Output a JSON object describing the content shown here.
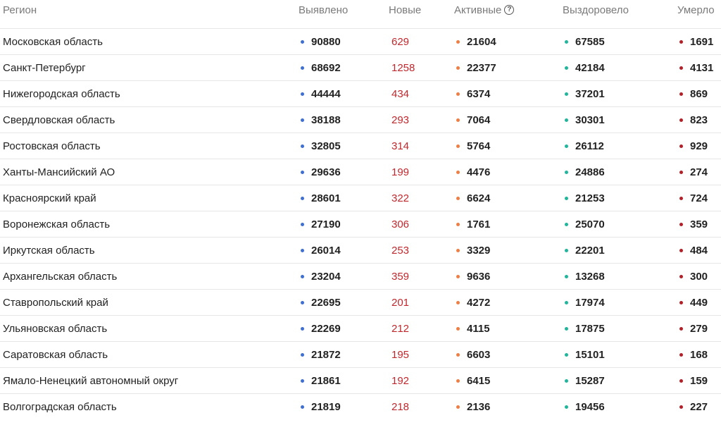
{
  "header": {
    "region": "Регион",
    "detected": "Выявлено",
    "new": "Новые",
    "active": "Активные",
    "active_help": "?",
    "recovered": "Выздоровело",
    "died": "Умерло"
  },
  "colors": {
    "detected_dot": "#3f6fd1",
    "active_dot": "#ef7e45",
    "recovered_dot": "#21b59b",
    "died_dot": "#b3202a",
    "new_text": "#c0282d"
  },
  "rows": [
    {
      "region": "Московская область",
      "detected": "90880",
      "new": "629",
      "active": "21604",
      "recovered": "67585",
      "died": "1691"
    },
    {
      "region": "Санкт-Петербург",
      "detected": "68692",
      "new": "1258",
      "active": "22377",
      "recovered": "42184",
      "died": "4131"
    },
    {
      "region": "Нижегородская область",
      "detected": "44444",
      "new": "434",
      "active": "6374",
      "recovered": "37201",
      "died": "869"
    },
    {
      "region": "Свердловская область",
      "detected": "38188",
      "new": "293",
      "active": "7064",
      "recovered": "30301",
      "died": "823"
    },
    {
      "region": "Ростовская область",
      "detected": "32805",
      "new": "314",
      "active": "5764",
      "recovered": "26112",
      "died": "929"
    },
    {
      "region": "Ханты-Мансийский АО",
      "detected": "29636",
      "new": "199",
      "active": "4476",
      "recovered": "24886",
      "died": "274"
    },
    {
      "region": "Красноярский край",
      "detected": "28601",
      "new": "322",
      "active": "6624",
      "recovered": "21253",
      "died": "724"
    },
    {
      "region": "Воронежская область",
      "detected": "27190",
      "new": "306",
      "active": "1761",
      "recovered": "25070",
      "died": "359"
    },
    {
      "region": "Иркутская область",
      "detected": "26014",
      "new": "253",
      "active": "3329",
      "recovered": "22201",
      "died": "484"
    },
    {
      "region": "Архангельская область",
      "detected": "23204",
      "new": "359",
      "active": "9636",
      "recovered": "13268",
      "died": "300"
    },
    {
      "region": "Ставропольский край",
      "detected": "22695",
      "new": "201",
      "active": "4272",
      "recovered": "17974",
      "died": "449"
    },
    {
      "region": "Ульяновская область",
      "detected": "22269",
      "new": "212",
      "active": "4115",
      "recovered": "17875",
      "died": "279"
    },
    {
      "region": "Саратовская область",
      "detected": "21872",
      "new": "195",
      "active": "6603",
      "recovered": "15101",
      "died": "168"
    },
    {
      "region": "Ямало-Ненецкий автономный округ",
      "detected": "21861",
      "new": "192",
      "active": "6415",
      "recovered": "15287",
      "died": "159"
    },
    {
      "region": "Волгоградская область",
      "detected": "21819",
      "new": "218",
      "active": "2136",
      "recovered": "19456",
      "died": "227"
    }
  ]
}
